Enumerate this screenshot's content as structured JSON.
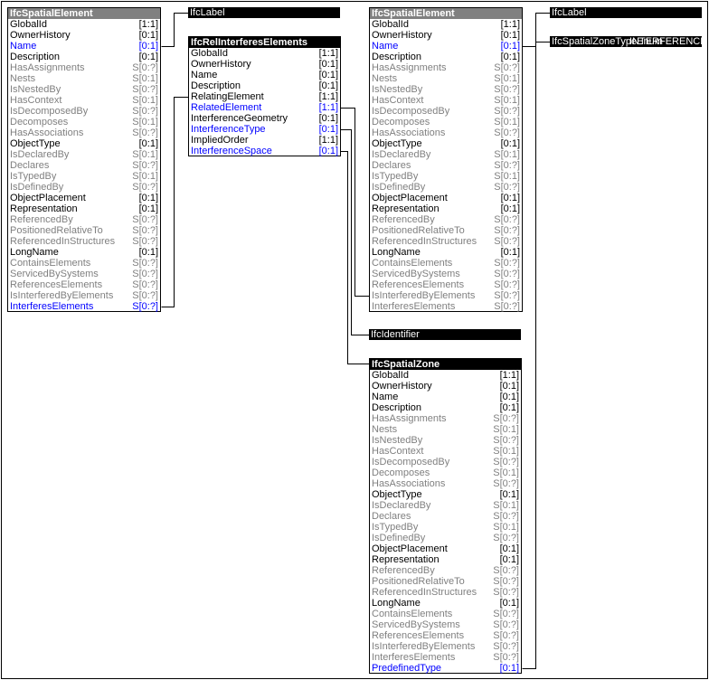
{
  "colors": {
    "header_abstract": "#808080",
    "header_entity": "#000000",
    "attr_normal": "#000000",
    "attr_highlight": "#0000ff",
    "attr_inverse": "#808080"
  },
  "entities": [
    {
      "id": "spatial-element-left",
      "title": "IfcSpatialElement",
      "abstract": true,
      "rows": [
        {
          "name": "GlobalId",
          "card": "[1:1]",
          "style": "normal"
        },
        {
          "name": "OwnerHistory",
          "card": "[0:1]",
          "style": "normal"
        },
        {
          "name": "Name",
          "card": "[0:1]",
          "style": "blue"
        },
        {
          "name": "Description",
          "card": "[0:1]",
          "style": "normal"
        },
        {
          "name": "HasAssignments",
          "card": "S[0:?]",
          "style": "gray"
        },
        {
          "name": "Nests",
          "card": "S[0:1]",
          "style": "gray"
        },
        {
          "name": "IsNestedBy",
          "card": "S[0:?]",
          "style": "gray"
        },
        {
          "name": "HasContext",
          "card": "S[0:1]",
          "style": "gray"
        },
        {
          "name": "IsDecomposedBy",
          "card": "S[0:?]",
          "style": "gray"
        },
        {
          "name": "Decomposes",
          "card": "S[0:1]",
          "style": "gray"
        },
        {
          "name": "HasAssociations",
          "card": "S[0:?]",
          "style": "gray"
        },
        {
          "name": "ObjectType",
          "card": "[0:1]",
          "style": "normal"
        },
        {
          "name": "IsDeclaredBy",
          "card": "S[0:1]",
          "style": "gray"
        },
        {
          "name": "Declares",
          "card": "S[0:?]",
          "style": "gray"
        },
        {
          "name": "IsTypedBy",
          "card": "S[0:1]",
          "style": "gray"
        },
        {
          "name": "IsDefinedBy",
          "card": "S[0:?]",
          "style": "gray"
        },
        {
          "name": "ObjectPlacement",
          "card": "[0:1]",
          "style": "normal"
        },
        {
          "name": "Representation",
          "card": "[0:1]",
          "style": "normal"
        },
        {
          "name": "ReferencedBy",
          "card": "S[0:?]",
          "style": "gray"
        },
        {
          "name": "PositionedRelativeTo",
          "card": "S[0:?]",
          "style": "gray"
        },
        {
          "name": "ReferencedInStructures",
          "card": "S[0:?]",
          "style": "gray"
        },
        {
          "name": "LongName",
          "card": "[0:1]",
          "style": "normal"
        },
        {
          "name": "ContainsElements",
          "card": "S[0:?]",
          "style": "gray"
        },
        {
          "name": "ServicedBySystems",
          "card": "S[0:?]",
          "style": "gray"
        },
        {
          "name": "ReferencesElements",
          "card": "S[0:?]",
          "style": "gray"
        },
        {
          "name": "IsInterferedByElements",
          "card": "S[0:?]",
          "style": "gray"
        },
        {
          "name": "InterferesElements",
          "card": "S[0:?]",
          "style": "blue"
        }
      ]
    },
    {
      "id": "rel-interferes-elements",
      "title": "IfcRelInterferesElements",
      "abstract": false,
      "rows": [
        {
          "name": "GlobalId",
          "card": "[1:1]",
          "style": "normal"
        },
        {
          "name": "OwnerHistory",
          "card": "[0:1]",
          "style": "normal"
        },
        {
          "name": "Name",
          "card": "[0:1]",
          "style": "normal"
        },
        {
          "name": "Description",
          "card": "[0:1]",
          "style": "normal"
        },
        {
          "name": "RelatingElement",
          "card": "[1:1]",
          "style": "normal"
        },
        {
          "name": "RelatedElement",
          "card": "[1:1]",
          "style": "blue"
        },
        {
          "name": "InterferenceGeometry",
          "card": "[0:1]",
          "style": "normal"
        },
        {
          "name": "InterferenceType",
          "card": "[0:1]",
          "style": "blue"
        },
        {
          "name": "ImpliedOrder",
          "card": "[1:1]",
          "style": "normal"
        },
        {
          "name": "InterferenceSpace",
          "card": "[0:1]",
          "style": "blue"
        }
      ]
    },
    {
      "id": "spatial-element-right",
      "title": "IfcSpatialElement",
      "abstract": true,
      "rows": [
        {
          "name": "GlobalId",
          "card": "[1:1]",
          "style": "normal"
        },
        {
          "name": "OwnerHistory",
          "card": "[0:1]",
          "style": "normal"
        },
        {
          "name": "Name",
          "card": "[0:1]",
          "style": "blue"
        },
        {
          "name": "Description",
          "card": "[0:1]",
          "style": "normal"
        },
        {
          "name": "HasAssignments",
          "card": "S[0:?]",
          "style": "gray"
        },
        {
          "name": "Nests",
          "card": "S[0:1]",
          "style": "gray"
        },
        {
          "name": "IsNestedBy",
          "card": "S[0:?]",
          "style": "gray"
        },
        {
          "name": "HasContext",
          "card": "S[0:1]",
          "style": "gray"
        },
        {
          "name": "IsDecomposedBy",
          "card": "S[0:?]",
          "style": "gray"
        },
        {
          "name": "Decomposes",
          "card": "S[0:1]",
          "style": "gray"
        },
        {
          "name": "HasAssociations",
          "card": "S[0:?]",
          "style": "gray"
        },
        {
          "name": "ObjectType",
          "card": "[0:1]",
          "style": "normal"
        },
        {
          "name": "IsDeclaredBy",
          "card": "S[0:1]",
          "style": "gray"
        },
        {
          "name": "Declares",
          "card": "S[0:?]",
          "style": "gray"
        },
        {
          "name": "IsTypedBy",
          "card": "S[0:1]",
          "style": "gray"
        },
        {
          "name": "IsDefinedBy",
          "card": "S[0:?]",
          "style": "gray"
        },
        {
          "name": "ObjectPlacement",
          "card": "[0:1]",
          "style": "normal"
        },
        {
          "name": "Representation",
          "card": "[0:1]",
          "style": "normal"
        },
        {
          "name": "ReferencedBy",
          "card": "S[0:?]",
          "style": "gray"
        },
        {
          "name": "PositionedRelativeTo",
          "card": "S[0:?]",
          "style": "gray"
        },
        {
          "name": "ReferencedInStructures",
          "card": "S[0:?]",
          "style": "gray"
        },
        {
          "name": "LongName",
          "card": "[0:1]",
          "style": "normal"
        },
        {
          "name": "ContainsElements",
          "card": "S[0:?]",
          "style": "gray"
        },
        {
          "name": "ServicedBySystems",
          "card": "S[0:?]",
          "style": "gray"
        },
        {
          "name": "ReferencesElements",
          "card": "S[0:?]",
          "style": "gray"
        },
        {
          "name": "IsInterferedByElements",
          "card": "S[0:?]",
          "style": "gray"
        },
        {
          "name": "InterferesElements",
          "card": "S[0:?]",
          "style": "gray"
        }
      ]
    },
    {
      "id": "spatial-zone",
      "title": "IfcSpatialZone",
      "abstract": false,
      "rows": [
        {
          "name": "GlobalId",
          "card": "[1:1]",
          "style": "normal"
        },
        {
          "name": "OwnerHistory",
          "card": "[0:1]",
          "style": "normal"
        },
        {
          "name": "Name",
          "card": "[0:1]",
          "style": "normal"
        },
        {
          "name": "Description",
          "card": "[0:1]",
          "style": "normal"
        },
        {
          "name": "HasAssignments",
          "card": "S[0:?]",
          "style": "gray"
        },
        {
          "name": "Nests",
          "card": "S[0:1]",
          "style": "gray"
        },
        {
          "name": "IsNestedBy",
          "card": "S[0:?]",
          "style": "gray"
        },
        {
          "name": "HasContext",
          "card": "S[0:1]",
          "style": "gray"
        },
        {
          "name": "IsDecomposedBy",
          "card": "S[0:?]",
          "style": "gray"
        },
        {
          "name": "Decomposes",
          "card": "S[0:1]",
          "style": "gray"
        },
        {
          "name": "HasAssociations",
          "card": "S[0:?]",
          "style": "gray"
        },
        {
          "name": "ObjectType",
          "card": "[0:1]",
          "style": "normal"
        },
        {
          "name": "IsDeclaredBy",
          "card": "S[0:1]",
          "style": "gray"
        },
        {
          "name": "Declares",
          "card": "S[0:?]",
          "style": "gray"
        },
        {
          "name": "IsTypedBy",
          "card": "S[0:1]",
          "style": "gray"
        },
        {
          "name": "IsDefinedBy",
          "card": "S[0:?]",
          "style": "gray"
        },
        {
          "name": "ObjectPlacement",
          "card": "[0:1]",
          "style": "normal"
        },
        {
          "name": "Representation",
          "card": "[0:1]",
          "style": "normal"
        },
        {
          "name": "ReferencedBy",
          "card": "S[0:?]",
          "style": "gray"
        },
        {
          "name": "PositionedRelativeTo",
          "card": "S[0:?]",
          "style": "gray"
        },
        {
          "name": "ReferencedInStructures",
          "card": "S[0:?]",
          "style": "gray"
        },
        {
          "name": "LongName",
          "card": "[0:1]",
          "style": "normal"
        },
        {
          "name": "ContainsElements",
          "card": "S[0:?]",
          "style": "gray"
        },
        {
          "name": "ServicedBySystems",
          "card": "S[0:?]",
          "style": "gray"
        },
        {
          "name": "ReferencesElements",
          "card": "S[0:?]",
          "style": "gray"
        },
        {
          "name": "IsInterferedByElements",
          "card": "S[0:?]",
          "style": "gray"
        },
        {
          "name": "InterferesElements",
          "card": "S[0:?]",
          "style": "gray"
        },
        {
          "name": "PredefinedType",
          "card": "[0:1]",
          "style": "blue"
        }
      ]
    }
  ],
  "types": [
    {
      "id": "label-left",
      "title": "IfcLabel"
    },
    {
      "id": "label-right",
      "title": "IfcLabel"
    },
    {
      "id": "spatial-zone-type-enum",
      "title": "IfcSpatialZoneTypeEnum",
      "overlay": "INTERFERENCE"
    },
    {
      "id": "identifier",
      "title": "IfcIdentifier"
    }
  ]
}
